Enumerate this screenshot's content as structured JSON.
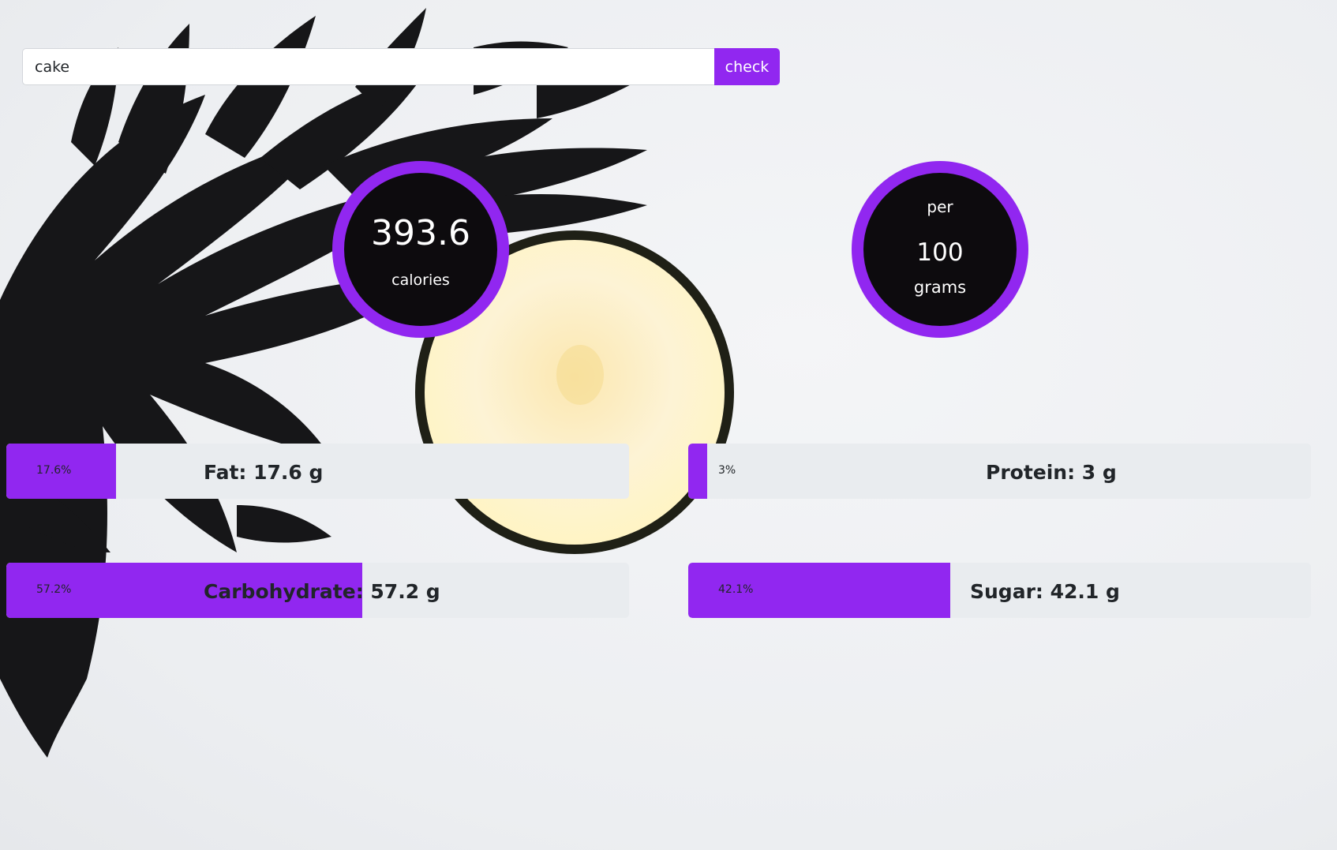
{
  "search": {
    "value": "cake",
    "placeholder": "",
    "button_label": "check"
  },
  "calories": {
    "value": "393.6",
    "label": "calories"
  },
  "serving": {
    "per_label": "per",
    "amount": "100",
    "unit": "grams"
  },
  "nutrients": {
    "fat": {
      "percent": 17.6,
      "percent_text": "17.6%",
      "label": "Fat: 17.6 g"
    },
    "protein": {
      "percent": 3,
      "percent_text": "3%",
      "label": "Protein: 3 g"
    },
    "carbohydrate": {
      "percent": 57.2,
      "percent_text": "57.2%",
      "label": "Carbohydrate: 57.2 g"
    },
    "sugar": {
      "percent": 42.1,
      "percent_text": "42.1%",
      "label": "Sugar: 42.1 g"
    }
  },
  "colors": {
    "accent": "#9127f0",
    "circle_bg": "#0d0b0e",
    "bar_track": "#e9ecef"
  }
}
